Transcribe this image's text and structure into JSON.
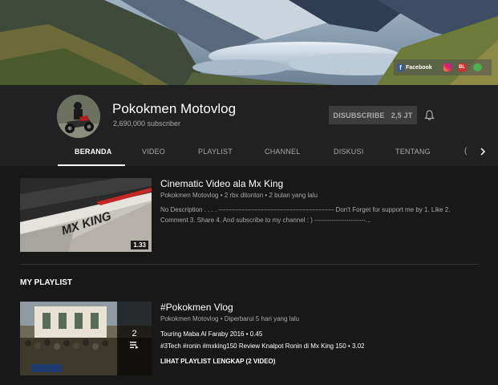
{
  "banner": {
    "facebook_label": "Facebook",
    "bl_label": "BL",
    "green_label": "ID"
  },
  "channel": {
    "name": "Pokokmen Motovlog",
    "subscribers": "2,690,000 subscriber",
    "unsubscribe_label": "DISUBSCRIBE",
    "subscriber_count_short": "2,5 JT"
  },
  "tabs": [
    {
      "label": "BERANDA",
      "active": true
    },
    {
      "label": "VIDEO"
    },
    {
      "label": "PLAYLIST"
    },
    {
      "label": "CHANNEL"
    },
    {
      "label": "DISKUSI"
    },
    {
      "label": "TENTANG"
    }
  ],
  "tab_more": "(",
  "featured_video": {
    "title": "Cinematic Video ala Mx King",
    "meta": "Pokokmen Motovlog • 2 rbx ditonton • 2 bulan yang lalu",
    "description": "No Description . . . . ------------------------------------------------------ Don't Forget for support me by 1. Like 2. Comment 3. Share 4. And subscribe to my channel : ) ------------------------...",
    "duration": "1.33",
    "thumb_text": "MX KING"
  },
  "section_title": "MY PLAYLIST",
  "playlist": {
    "title": "#Pokokmen Vlog",
    "meta": "Pokokmen Motovlog • Diperbarui 5 hari yang lalu",
    "count": "2",
    "items": [
      "Touring Maba Al Faraby 2016 • 0.45",
      "#3Tech #ronin #mxking150 Review Knalpot Ronin di Mx King 150 • 3.02"
    ],
    "view_all": "LIHAT PLAYLIST LENGKAP (2 VIDEO)"
  }
}
